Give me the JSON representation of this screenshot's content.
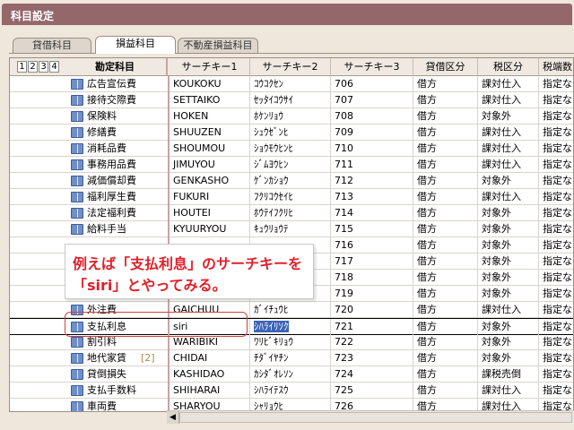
{
  "window": {
    "title": "科目設定"
  },
  "tabs": [
    {
      "label": "貸借科目",
      "active": false
    },
    {
      "label": "損益科目",
      "active": true
    },
    {
      "label": "不動産損益科目",
      "active": false
    }
  ],
  "header": {
    "levels": [
      "1",
      "2",
      "3",
      "4"
    ],
    "columns": [
      "勘定科目",
      "サーチキー1",
      "サーチキー2",
      "サーチキー3",
      "貸借区分",
      "税区分",
      "税端数"
    ]
  },
  "rows": [
    {
      "name": "広告宣伝費",
      "suffix": "",
      "key1": "KOUKOKU",
      "key2": "ｺｳｺｸｾﾝ",
      "key3": "706",
      "dc": "借方",
      "tax": "課対仕入",
      "frac": "指定な"
    },
    {
      "name": "接待交際費",
      "suffix": "",
      "key1": "SETTAIKO",
      "key2": "ｾｯﾀｲｺｳｻｲ",
      "key3": "707",
      "dc": "借方",
      "tax": "課対仕入",
      "frac": "指定な"
    },
    {
      "name": "保険料",
      "suffix": "",
      "key1": "HOKEN",
      "key2": "ﾎｹﾝﾘｮｳ",
      "key3": "708",
      "dc": "借方",
      "tax": "対象外",
      "frac": "指定な"
    },
    {
      "name": "修繕費",
      "suffix": "",
      "key1": "SHUUZEN",
      "key2": "ｼｭｳｾﾞﾝﾋ",
      "key3": "709",
      "dc": "借方",
      "tax": "課対仕入",
      "frac": "指定な"
    },
    {
      "name": "消耗品費",
      "suffix": "",
      "key1": "SHOUMOU",
      "key2": "ｼｮｳﾓｳﾋﾝﾋ",
      "key3": "710",
      "dc": "借方",
      "tax": "課対仕入",
      "frac": "指定な"
    },
    {
      "name": "事務用品費",
      "suffix": "",
      "key1": "JIMUYOU",
      "key2": "ｼﾞﾑﾖｳﾋﾝ",
      "key3": "711",
      "dc": "借方",
      "tax": "課対仕入",
      "frac": "指定な"
    },
    {
      "name": "減価償却費",
      "suffix": "",
      "key1": "GENKASHO",
      "key2": "ｹﾞﾝｶｼｮｳ",
      "key3": "712",
      "dc": "借方",
      "tax": "対象外",
      "frac": "指定な"
    },
    {
      "name": "福利厚生費",
      "suffix": "",
      "key1": "FUKURI",
      "key2": "ﾌｸﾘｺｳｾｲﾋ",
      "key3": "713",
      "dc": "借方",
      "tax": "課対仕入",
      "frac": "指定な"
    },
    {
      "name": "法定福利費",
      "suffix": "",
      "key1": "HOUTEI",
      "key2": "ﾎｳﾃｲﾌｸﾘﾋ",
      "key3": "714",
      "dc": "借方",
      "tax": "対象外",
      "frac": "指定な"
    },
    {
      "name": "給料手当",
      "suffix": "",
      "key1": "KYUURYOU",
      "key2": "ｷｭｳﾘｮｳﾃ",
      "key3": "715",
      "dc": "借方",
      "tax": "対象外",
      "frac": "指定な"
    },
    {
      "name": "",
      "suffix": "",
      "key1": "",
      "key2": "",
      "key3": "716",
      "dc": "借方",
      "tax": "対象外",
      "frac": "指定な"
    },
    {
      "name": "",
      "suffix": "",
      "key1": "",
      "key2": "",
      "key3": "717",
      "dc": "借方",
      "tax": "対象外",
      "frac": "指定な"
    },
    {
      "name": "",
      "suffix": "",
      "key1": "",
      "key2": "",
      "key3": "718",
      "dc": "借方",
      "tax": "対象外",
      "frac": "指定な"
    },
    {
      "name": "",
      "suffix": "",
      "key1": "",
      "key2": "",
      "key3": "719",
      "dc": "借方",
      "tax": "対象外",
      "frac": "指定な"
    },
    {
      "name": "外注費",
      "suffix": "",
      "key1": "GAICHUU",
      "key2": "ｶﾞｲﾁｭｳﾋ",
      "key3": "720",
      "dc": "借方",
      "tax": "課対仕入",
      "frac": "指定な"
    },
    {
      "name": "支払利息",
      "suffix": "",
      "key1": "siri",
      "key2": "ｼﾊﾗｲﾘｿｸ",
      "key3": "721",
      "dc": "借方",
      "tax": "対象外",
      "frac": "指定な",
      "selected": true
    },
    {
      "name": "割引料",
      "suffix": "",
      "key1": "WARIBIKI",
      "key2": "ﾜﾘﾋﾞｷﾘｮｳ",
      "key3": "722",
      "dc": "借方",
      "tax": "対象外",
      "frac": "指定な"
    },
    {
      "name": "地代家賃",
      "suffix": "[2]",
      "key1": "CHIDAI",
      "key2": "ﾁﾀﾞｲﾔﾁﾝ",
      "key3": "723",
      "dc": "借方",
      "tax": "対象外",
      "frac": "指定な"
    },
    {
      "name": "貸倒損失",
      "suffix": "",
      "key1": "KASHIDAO",
      "key2": "ｶｼﾀﾞｵﾚｿﾝ",
      "key3": "724",
      "dc": "借方",
      "tax": "課税売倒",
      "frac": "指定な"
    },
    {
      "name": "支払手数料",
      "suffix": "",
      "key1": "SHIHARAI",
      "key2": "ｼﾊﾗｲﾃｽｳ",
      "key3": "725",
      "dc": "借方",
      "tax": "課対仕入",
      "frac": "指定な"
    },
    {
      "name": "車両費",
      "suffix": "",
      "key1": "SHARYOU",
      "key2": "ｼｬﾘｮｳﾋ",
      "key3": "726",
      "dc": "借方",
      "tax": "課対仕入",
      "frac": "指定な"
    }
  ],
  "callout": {
    "line1": "例えば「支払利息」のサーチキーを",
    "line2": "「siri」とやってみる。"
  },
  "colors": {
    "titlebar": "#94676b",
    "background": "#efe6dc",
    "selection": "#3b63b8",
    "callout_text": "#e0202a"
  }
}
